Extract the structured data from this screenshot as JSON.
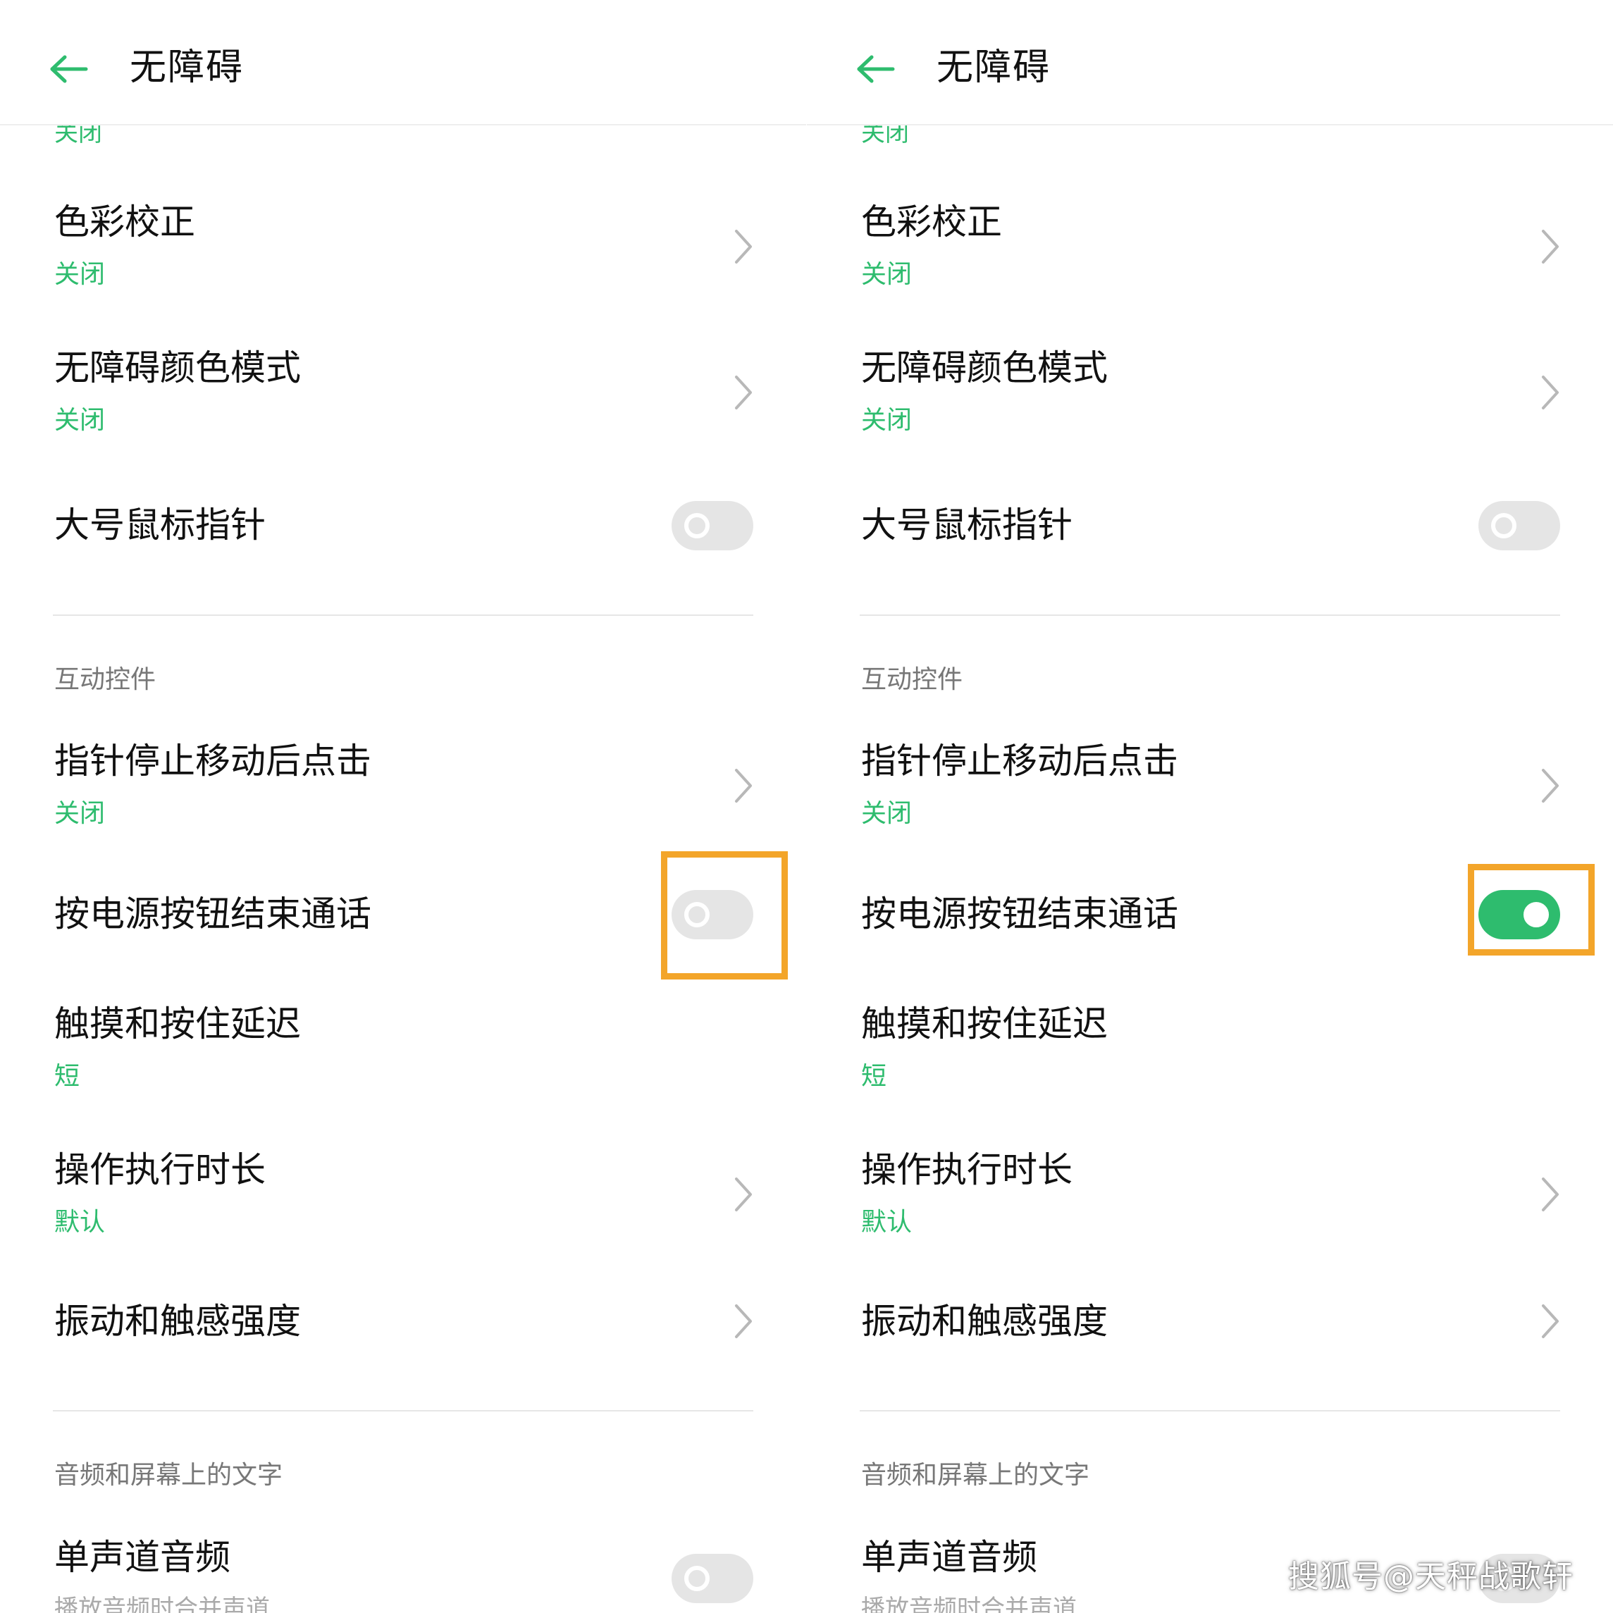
{
  "panels": [
    {
      "header": {
        "title": "无障碍"
      },
      "top_partial_value": "关闭",
      "rows": {
        "color_correction": {
          "title": "色彩校正",
          "value": "关闭"
        },
        "color_mode": {
          "title": "无障碍颜色模式",
          "value": "关闭"
        },
        "large_pointer": {
          "title": "大号鼠标指针",
          "switch_on": false
        },
        "section_interaction": "互动控件",
        "click_after_stop": {
          "title": "指针停止移动后点击",
          "value": "关闭"
        },
        "power_ends_call": {
          "title": "按电源按钮结束通话",
          "switch_on": false
        },
        "touch_delay": {
          "title": "触摸和按住延迟",
          "value": "短"
        },
        "action_duration": {
          "title": "操作执行时长",
          "value": "默认"
        },
        "vibration": {
          "title": "振动和触感强度"
        },
        "section_audio": "音频和屏幕上的文字",
        "mono_audio": {
          "title": "单声道音频",
          "desc": "播放音频时合并声道",
          "switch_on": false
        }
      }
    },
    {
      "header": {
        "title": "无障碍"
      },
      "top_partial_value": "关闭",
      "rows": {
        "color_correction": {
          "title": "色彩校正",
          "value": "关闭"
        },
        "color_mode": {
          "title": "无障碍颜色模式",
          "value": "关闭"
        },
        "large_pointer": {
          "title": "大号鼠标指针",
          "switch_on": false
        },
        "section_interaction": "互动控件",
        "click_after_stop": {
          "title": "指针停止移动后点击",
          "value": "关闭"
        },
        "power_ends_call": {
          "title": "按电源按钮结束通话",
          "switch_on": true
        },
        "touch_delay": {
          "title": "触摸和按住延迟",
          "value": "短"
        },
        "action_duration": {
          "title": "操作执行时长",
          "value": "默认"
        },
        "vibration": {
          "title": "振动和触感强度"
        },
        "section_audio": "音频和屏幕上的文字",
        "mono_audio": {
          "title": "单声道音频",
          "desc": "播放音频时合并声道",
          "switch_on": false
        }
      }
    }
  ],
  "watermark": "搜狐号@天秤战歌轩",
  "colors": {
    "accent": "#2ebc6e",
    "highlight": "#f3a52a",
    "switch_off": "#e5e5e5",
    "title_text": "#111111",
    "section_text": "#777777"
  },
  "icons": {
    "back": "back-arrow-icon",
    "chevron": "chevron-right-icon"
  }
}
